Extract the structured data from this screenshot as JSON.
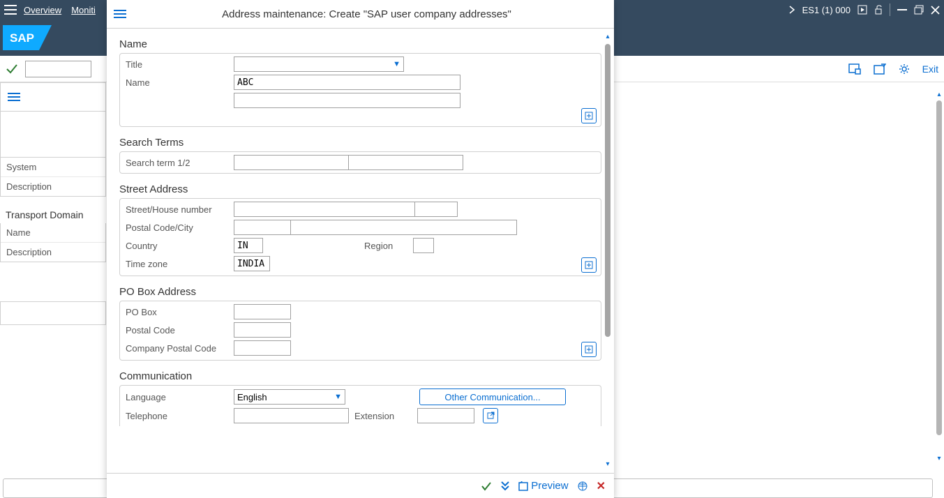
{
  "topmenu": {
    "overview": "Overview",
    "moniti": "Moniti",
    "system_label": "ES1 (1) 000"
  },
  "toolbar": {
    "exit_label": "Exit"
  },
  "sidebar": {
    "items": [
      "System",
      "Description"
    ],
    "transport_domain_title": "Transport Domain",
    "transport_items": [
      "Name",
      "Description"
    ]
  },
  "dialog": {
    "title": "Address maintenance: Create \"SAP user company addresses\"",
    "sections": {
      "name": {
        "label": "Name",
        "title_label": "Title",
        "name_label": "Name",
        "name_value": "ABC"
      },
      "search": {
        "label": "Search Terms",
        "search_label": "Search term 1/2"
      },
      "street": {
        "label": "Street Address",
        "street_label": "Street/House number",
        "postal_label": "Postal Code/City",
        "country_label": "Country",
        "country_value": "IN",
        "region_label": "Region",
        "timezone_label": "Time zone",
        "timezone_value": "INDIA"
      },
      "pobox": {
        "label": "PO Box Address",
        "pobox_label": "PO Box",
        "postal_label": "Postal Code",
        "company_postal_label": "Company Postal Code"
      },
      "comm": {
        "label": "Communication",
        "language_label": "Language",
        "language_value": "English",
        "other_comm_label": "Other Communication...",
        "telephone_label": "Telephone",
        "extension_label": "Extension"
      }
    },
    "footer": {
      "preview_label": "Preview"
    }
  }
}
